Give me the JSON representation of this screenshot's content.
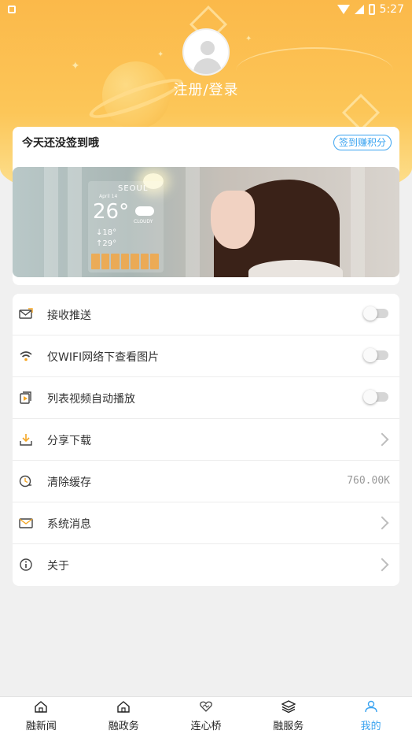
{
  "status_bar": {
    "time": "5:27"
  },
  "profile": {
    "login_label": "注册/登录"
  },
  "sign_card": {
    "title": "今天还没签到哦",
    "button": "签到赚积分"
  },
  "banner": {
    "city": "SEOUL",
    "date": "April 14",
    "temperature": "26°",
    "condition": "CLOUDY",
    "low": "↓18°",
    "high": "↑29°"
  },
  "settings": {
    "items": [
      {
        "label": "接收推送",
        "control": "toggle",
        "on": false,
        "icon": "mail-receive-icon"
      },
      {
        "label": "仅WIFI网络下查看图片",
        "control": "toggle",
        "on": false,
        "icon": "wifi-icon"
      },
      {
        "label": "列表视频自动播放",
        "control": "toggle",
        "on": false,
        "icon": "video-play-icon"
      },
      {
        "label": "分享下载",
        "control": "chevron",
        "icon": "download-icon"
      },
      {
        "label": "清除缓存",
        "control": "value",
        "value": "760.00K",
        "icon": "cache-clock-icon"
      },
      {
        "label": "系统消息",
        "control": "chevron",
        "icon": "envelope-icon"
      },
      {
        "label": "关于",
        "control": "chevron",
        "icon": "info-icon"
      }
    ]
  },
  "bottom_nav": {
    "items": [
      {
        "label": "融新闻",
        "icon": "home-icon",
        "active": false
      },
      {
        "label": "融政务",
        "icon": "government-icon",
        "active": false
      },
      {
        "label": "连心桥",
        "icon": "heart-link-icon",
        "active": false
      },
      {
        "label": "融服务",
        "icon": "layers-icon",
        "active": false
      },
      {
        "label": "我的",
        "icon": "user-icon",
        "active": true
      }
    ]
  },
  "colors": {
    "header_gradient_top": "#fbb94a",
    "accent_blue": "#3aa3f0",
    "background": "#f0f0f0"
  }
}
